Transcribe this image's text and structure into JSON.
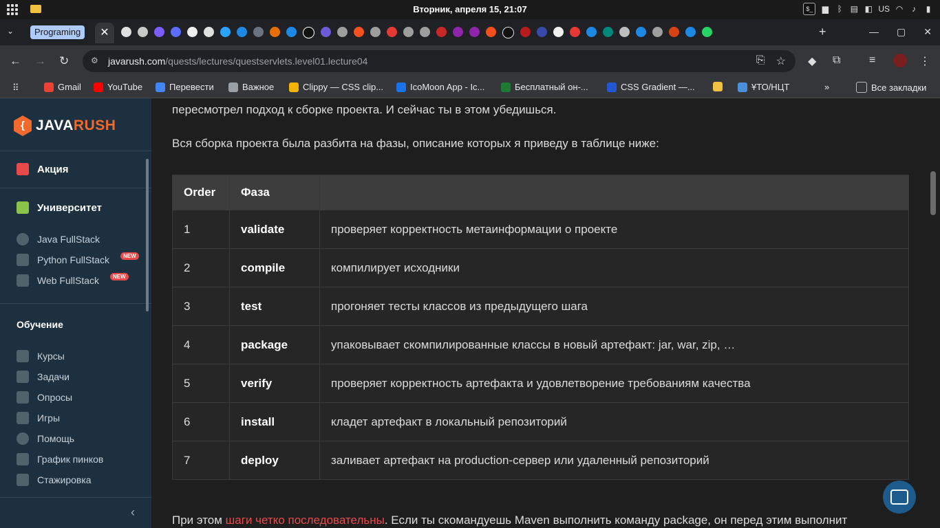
{
  "os": {
    "clock": "Вторник, апреля 15, 21:07",
    "keyboard_layout": "US"
  },
  "browser": {
    "tab_group_label": "Programing",
    "active_tab_close": "✕",
    "url_domain": "javarush.com",
    "url_path": "/quests/lectures/questservlets.level01.lecture04",
    "bookmarks": [
      {
        "label": "Gmail",
        "color": "#ea4335"
      },
      {
        "label": "YouTube",
        "color": "#ff0000"
      },
      {
        "label": "Перевести",
        "color": "#4285f4"
      },
      {
        "label": "Важное",
        "color": "#9aa0a6"
      },
      {
        "label": "Clippy — CSS clip...",
        "color": "#f4b400"
      },
      {
        "label": "IcoMoon App - Ic...",
        "color": "#1a73e8"
      },
      {
        "label": "Бесплатный он-...",
        "color": "#1e7b34"
      },
      {
        "label": "CSS Gradient —...",
        "color": "#2457d6"
      },
      {
        "label": "",
        "color": "#f0c040"
      },
      {
        "label": "ҰТО/НЦТ",
        "color": "#4a8fd9"
      }
    ],
    "more_bookmarks": "»",
    "all_bookmarks": "Все закладки"
  },
  "sidebar": {
    "logo_mark": "{",
    "logo_java": "JAVA",
    "logo_rush": "RUSH",
    "promo": "Акция",
    "university": "Университет",
    "tracks": [
      {
        "label": "Java FullStack",
        "badge": ""
      },
      {
        "label": "Python FullStack",
        "badge": "NEW"
      },
      {
        "label": "Web FullStack",
        "badge": "NEW"
      }
    ],
    "learning_title": "Обучение",
    "learning_items": [
      "Курсы",
      "Задачи",
      "Опросы",
      "Игры",
      "Помощь",
      "График пинков",
      "Стажировка"
    ]
  },
  "content": {
    "line1": "пересмотрел подход к сборке проекта. И сейчас ты в этом убедишься.",
    "line2": "Вся сборка проекта была разбита на фазы, описание которых я приведу в таблице ниже:",
    "table": {
      "headers": [
        "Order",
        "Фаза",
        ""
      ],
      "rows": [
        [
          "1",
          "validate",
          "проверяет корректность метаинформации о проекте"
        ],
        [
          "2",
          "compile",
          "компилирует исходники"
        ],
        [
          "3",
          "test",
          "прогоняет тесты классов из предыдущего шага"
        ],
        [
          "4",
          "package",
          "упаковывает скомпилированные классы в новый артефакт: jar, war, zip, …"
        ],
        [
          "5",
          "verify",
          "проверяет корректность артефакта и удовлетворение требованиям качества"
        ],
        [
          "6",
          "install",
          "кладет артефакт в локальный репозиторий"
        ],
        [
          "7",
          "deploy",
          "заливает артефакт на production-сервер или удаленный репозиторий"
        ]
      ]
    },
    "bottom_prefix": "При этом ",
    "bottom_link": "шаги четко последовательны",
    "bottom_suffix": ". Если ты скомандуешь Maven выполнить команду package, он перед этим выполнит"
  }
}
